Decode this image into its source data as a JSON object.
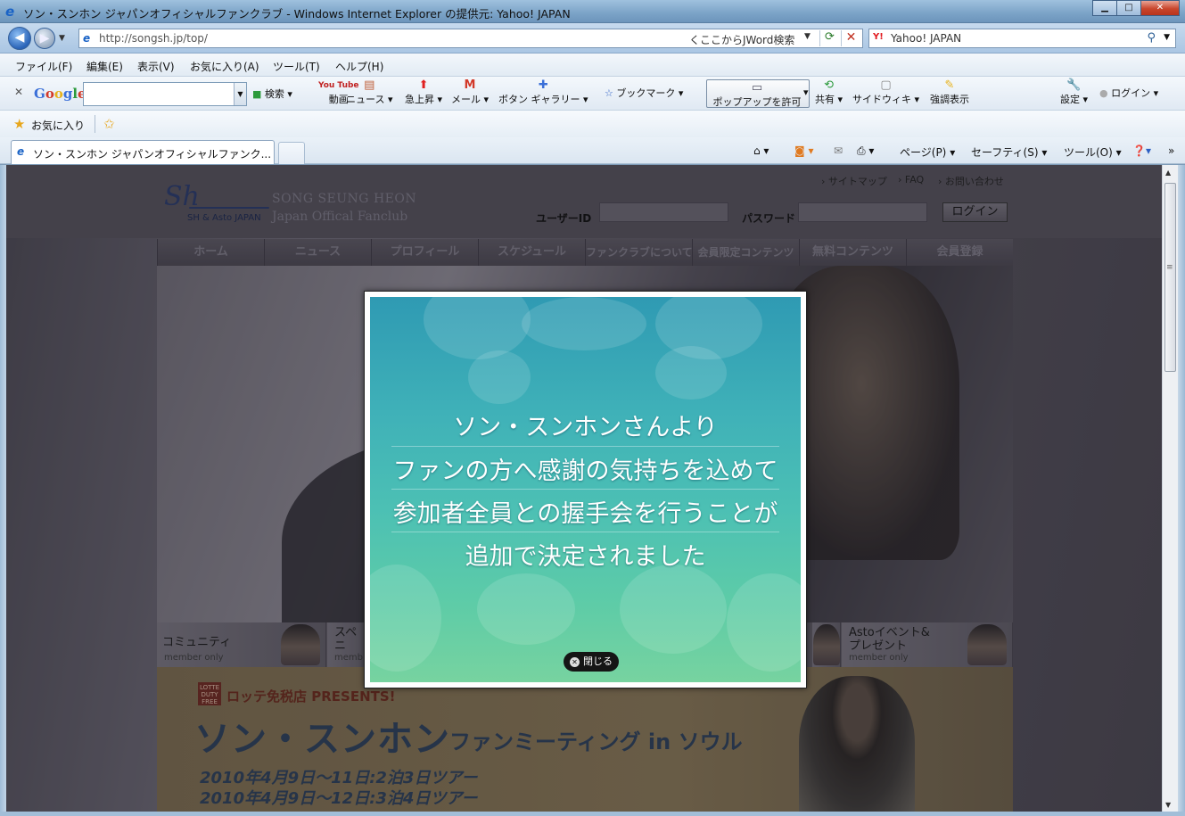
{
  "window": {
    "title": "ソン・スンホン ジャパンオフィシャルファンクラブ - Windows Internet Explorer の提供元: Yahoo! JAPAN",
    "minimize": "▁",
    "maximize": "□",
    "close": "✕"
  },
  "address": {
    "url": "http://songsh.jp/top/",
    "jword_placeholder": "くここからJWord検索",
    "search_engine": "Yahoo! JAPAN"
  },
  "menu": [
    "ファイル(F)",
    "編集(E)",
    "表示(V)",
    "お気に入り(A)",
    "ツール(T)",
    "ヘルプ(H)"
  ],
  "google_toolbar": {
    "logo": "Google",
    "search_label": "検索",
    "video": "動画",
    "news": "ニュース",
    "trending": "急上昇",
    "mail": "メール",
    "button_gallery": "ボタン ギャラリー",
    "bookmarks": "ブックマーク",
    "popup_allow": "ポップアップを許可",
    "share": "共有",
    "sidewiki": "サイドウィキ",
    "highlight": "強調表示",
    "settings": "設定",
    "login": "ログイン"
  },
  "favorites": {
    "label": "お気に入り"
  },
  "tab": {
    "label": "ソン・スンホン ジャパンオフィシャルファンク..."
  },
  "command_bar": {
    "page": "ページ(P)",
    "safety": "セーフティ(S)",
    "tools": "ツール(O)"
  },
  "site": {
    "logo_mark": "Sh",
    "logo_sub": "SH & Asto JAPAN",
    "brand_line1": "SONG SEUNG HEON",
    "brand_line2": "Japan Offical Fanclub",
    "links": [
      "サイトマップ",
      "FAQ",
      "お問い合わせ"
    ],
    "user_id_label": "ユーザーID",
    "password_label": "パスワード",
    "login_button": "ログイン",
    "nav": [
      "ホーム",
      "ニュース",
      "プロフィール",
      "スケジュール",
      "ファンクラブについて",
      "会員限定コンテンツ",
      "無料コンテンツ",
      "会員登録"
    ],
    "banners": [
      {
        "title": "コミュニティ",
        "sub": "member only"
      },
      {
        "title": "スペ",
        "sub": "memb"
      },
      {
        "title": "Astoイベント&\nプレゼント",
        "sub": "member only"
      }
    ],
    "banner_partial_second_line": "ニ",
    "promo": {
      "lotte_badge": "LOTTE DUTY FREE",
      "lotte": "ロッテ免税店 PRESENTS!",
      "title": "ソン・スンホン",
      "subtitle": "ファンミーティング in ソウル",
      "date1": "2010年4月9日～11日:2泊3日ツアー",
      "date2": "2010年4月9日～12日:3泊4日ツアー"
    }
  },
  "modal": {
    "lines": [
      "ソン・スンホンさんより",
      "ファンの方へ感謝の気持ちを込めて",
      "参加者全員との握手会を行うことが",
      "追加で決定されました"
    ],
    "close_label": "閉じる"
  },
  "colors": {
    "modal_top": "#2f9ab3",
    "modal_bottom": "#77d3a0",
    "page_bg": "#5a5660"
  }
}
